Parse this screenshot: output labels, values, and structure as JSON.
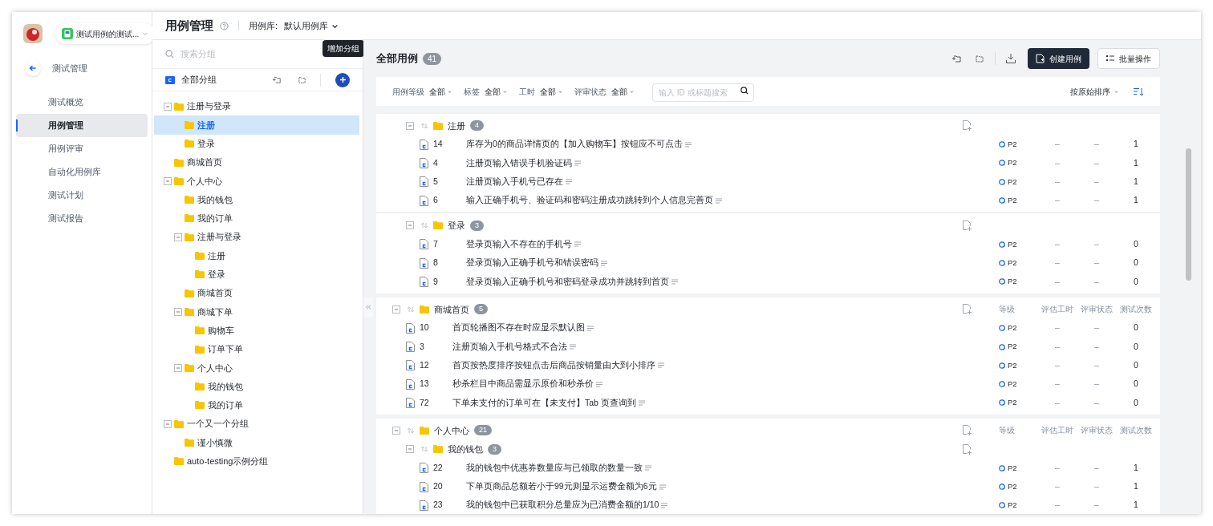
{
  "project": {
    "name": "测试用例的测试..."
  },
  "nav": {
    "back": "测试管理",
    "items": [
      {
        "label": "测试概览",
        "selected": false
      },
      {
        "label": "用例管理",
        "selected": true
      },
      {
        "label": "用例评审",
        "selected": false
      },
      {
        "label": "自动化用例库",
        "selected": false
      },
      {
        "label": "测试计划",
        "selected": false
      },
      {
        "label": "测试报告",
        "selected": false
      }
    ]
  },
  "header": {
    "title": "用例管理",
    "library_label": "用例库:",
    "library": "默认用例库"
  },
  "group_panel": {
    "search_placeholder": "搜索分组",
    "all_groups": "全部分组",
    "tooltip": "增加分组",
    "tree": [
      {
        "label": "注册与登录",
        "selected": false,
        "expanded": true,
        "children": [
          {
            "label": "注册",
            "selected": true
          },
          {
            "label": "登录",
            "selected": false
          }
        ]
      },
      {
        "label": "商城首页",
        "selected": false
      },
      {
        "label": "个人中心",
        "selected": false,
        "expanded": true,
        "children": [
          {
            "label": "我的钱包",
            "selected": false
          },
          {
            "label": "我的订单",
            "selected": false
          },
          {
            "label": "注册与登录",
            "selected": false,
            "expanded": true,
            "children": [
              {
                "label": "注册",
                "selected": false
              },
              {
                "label": "登录",
                "selected": false
              }
            ]
          },
          {
            "label": "商城首页",
            "selected": false
          },
          {
            "label": "商城下单",
            "selected": false,
            "expanded": true,
            "children": [
              {
                "label": "购物车",
                "selected": false
              },
              {
                "label": "订单下单",
                "selected": false
              }
            ]
          },
          {
            "label": "个人中心",
            "selected": false,
            "expanded": true,
            "children": [
              {
                "label": "我的钱包",
                "selected": false
              },
              {
                "label": "我的订单",
                "selected": false
              }
            ]
          }
        ]
      },
      {
        "label": "一个又一个分组",
        "selected": false,
        "expanded": true,
        "children": [
          {
            "label": "谨小慎微",
            "selected": false
          }
        ]
      },
      {
        "label": "auto-testing示例分组",
        "selected": false
      }
    ]
  },
  "main": {
    "title": "全部用例",
    "count": "41",
    "create_button": "创建用例",
    "batch_button": "批量操作",
    "filters": [
      {
        "label": "用例等级",
        "value": "全部"
      },
      {
        "label": "标签",
        "value": "全部"
      },
      {
        "label": "工时",
        "value": "全部"
      },
      {
        "label": "评审状态",
        "value": "全部"
      }
    ],
    "search_placeholder": "输入 ID 或标题搜索",
    "sort": "按原始排序"
  },
  "cards": [
    {
      "groups": [
        {
          "name": "注册",
          "count": "4",
          "cases": [
            {
              "id": "14",
              "title": "库存为0的商品详情页的【加入购物车】按钮应不可点击",
              "level": "P2",
              "hours": "–",
              "review": "–",
              "runs": "1"
            },
            {
              "id": "4",
              "title": "注册页输入错误手机验证码",
              "level": "P2",
              "hours": "–",
              "review": "–",
              "runs": "1"
            },
            {
              "id": "5",
              "title": "注册页输入手机号已存在",
              "level": "P2",
              "hours": "–",
              "review": "–",
              "runs": "1"
            },
            {
              "id": "6",
              "title": "输入正确手机号、验证码和密码注册成功跳转到个人信息完善页",
              "level": "P2",
              "hours": "–",
              "review": "–",
              "runs": "1"
            }
          ]
        },
        {
          "name": "登录",
          "count": "3",
          "cases": [
            {
              "id": "7",
              "title": "登录页输入不存在的手机号",
              "level": "P2",
              "hours": "–",
              "review": "–",
              "runs": "0"
            },
            {
              "id": "8",
              "title": "登录页输入正确手机号和错误密码",
              "level": "P2",
              "hours": "–",
              "review": "–",
              "runs": "0"
            },
            {
              "id": "9",
              "title": "登录页输入正确手机号和密码登录成功并跳转到首页",
              "level": "P2",
              "hours": "–",
              "review": "–",
              "runs": "0"
            }
          ]
        }
      ]
    },
    {
      "name": "商城首页",
      "count": "5",
      "columns": [
        "等级",
        "评估工时",
        "评审状态",
        "测试次数"
      ],
      "cases": [
        {
          "id": "10",
          "title": "首页轮播图不存在时应显示默认图",
          "level": "P2",
          "hours": "–",
          "review": "–",
          "runs": "0"
        },
        {
          "id": "3",
          "title": "注册页输入手机号格式不合法",
          "level": "P2",
          "hours": "–",
          "review": "–",
          "runs": "0"
        },
        {
          "id": "12",
          "title": "首页按热度排序按钮点击后商品按销量由大到小排序",
          "level": "P2",
          "hours": "–",
          "review": "–",
          "runs": "0"
        },
        {
          "id": "13",
          "title": "秒杀栏目中商品需显示原价和秒杀价",
          "level": "P2",
          "hours": "–",
          "review": "–",
          "runs": "0"
        },
        {
          "id": "72",
          "title": "下单未支付的订单可在【未支付】Tab 页查询到",
          "level": "P2",
          "hours": "–",
          "review": "–",
          "runs": "0"
        }
      ]
    },
    {
      "name": "个人中心",
      "count": "21",
      "columns": [
        "等级",
        "评估工时",
        "评审状态",
        "测试次数"
      ],
      "groups": [
        {
          "name": "我的钱包",
          "count": "3",
          "cases": [
            {
              "id": "22",
              "title": "我的钱包中优惠券数量应与已领取的数量一致",
              "level": "P2",
              "hours": "–",
              "review": "–",
              "runs": "1"
            },
            {
              "id": "20",
              "title": "下单页商品总额若小于99元则显示运费金额为6元",
              "level": "P2",
              "hours": "–",
              "review": "–",
              "runs": "1"
            },
            {
              "id": "23",
              "title": "我的钱包中已获取积分总量应为已消费金额的1/10",
              "level": "P2",
              "hours": "–",
              "review": "–",
              "runs": "1"
            }
          ]
        }
      ]
    }
  ]
}
